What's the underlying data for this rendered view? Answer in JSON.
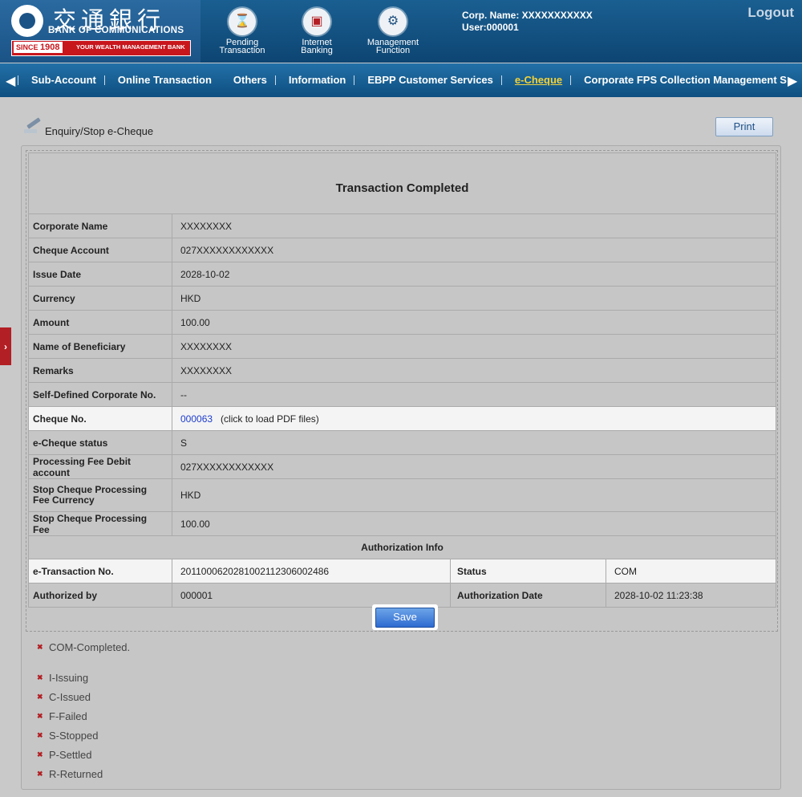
{
  "header": {
    "logo_cn": "交通銀行",
    "logo_en": "BANK OF COMMUNICATIONS",
    "since_label": "SINCE",
    "since_year": "1908",
    "slogan": "YOUR WEALTH MANAGEMENT BANK",
    "buttons": [
      {
        "label": "Pending Transaction",
        "icon": "pending-icon"
      },
      {
        "label": "Internet Banking",
        "icon": "monitor-icon"
      },
      {
        "label": "Management Function",
        "icon": "gears-icon"
      }
    ],
    "corp_name": "Corp. Name: XXXXXXXXXXX",
    "user": "User:000001",
    "logout": "Logout"
  },
  "nav": {
    "items": [
      "Sub-Account",
      "Online Transaction",
      "Others",
      "Information",
      "EBPP Customer Services",
      "e-Cheque",
      "Corporate FPS Collection Management S"
    ],
    "active": "e-Cheque"
  },
  "page": {
    "title": "Enquiry/Stop e-Cheque",
    "print": "Print",
    "table_title": "Transaction Completed",
    "rows": [
      {
        "label": "Corporate Name",
        "value": "XXXXXXXX"
      },
      {
        "label": "Cheque Account",
        "value": "027XXXXXXXXXXXX"
      },
      {
        "label": "Issue Date",
        "value": "2028-10-02"
      },
      {
        "label": "Currency",
        "value": "HKD"
      },
      {
        "label": "Amount",
        "value": "100.00"
      },
      {
        "label": "Name of Beneficiary",
        "value": "XXXXXXXX"
      },
      {
        "label": "Remarks",
        "value": "XXXXXXXX"
      },
      {
        "label": "Self-Defined Corporate No.",
        "value": "--"
      },
      {
        "label": "Cheque No.",
        "value": "000063",
        "hint": "(click to load PDF files)"
      },
      {
        "label": "e-Cheque status",
        "value": "S"
      },
      {
        "label": "Processing Fee Debit account",
        "value": "027XXXXXXXXXXXX"
      },
      {
        "label": "Stop Cheque Processing Fee Currency",
        "value": "HKD"
      },
      {
        "label": "Stop Cheque Processing Fee",
        "value": "100.00"
      }
    ],
    "auth_title": "Authorization Info",
    "auth": {
      "etx_label": "e-Transaction No.",
      "etx_value": "20110006202810021123060024​86",
      "status_label": "Status",
      "status_value": "COM",
      "by_label": "Authorized by",
      "by_value": "000001",
      "date_label": "Authorization Date",
      "date_value": "2028-10-02 11:23:38"
    },
    "save": "Save",
    "notes_first": "COM-Completed.",
    "notes": [
      "I-Issuing",
      "C-Issued",
      "F-Failed",
      "S-Stopped",
      "P-Settled",
      "R-Returned"
    ]
  }
}
